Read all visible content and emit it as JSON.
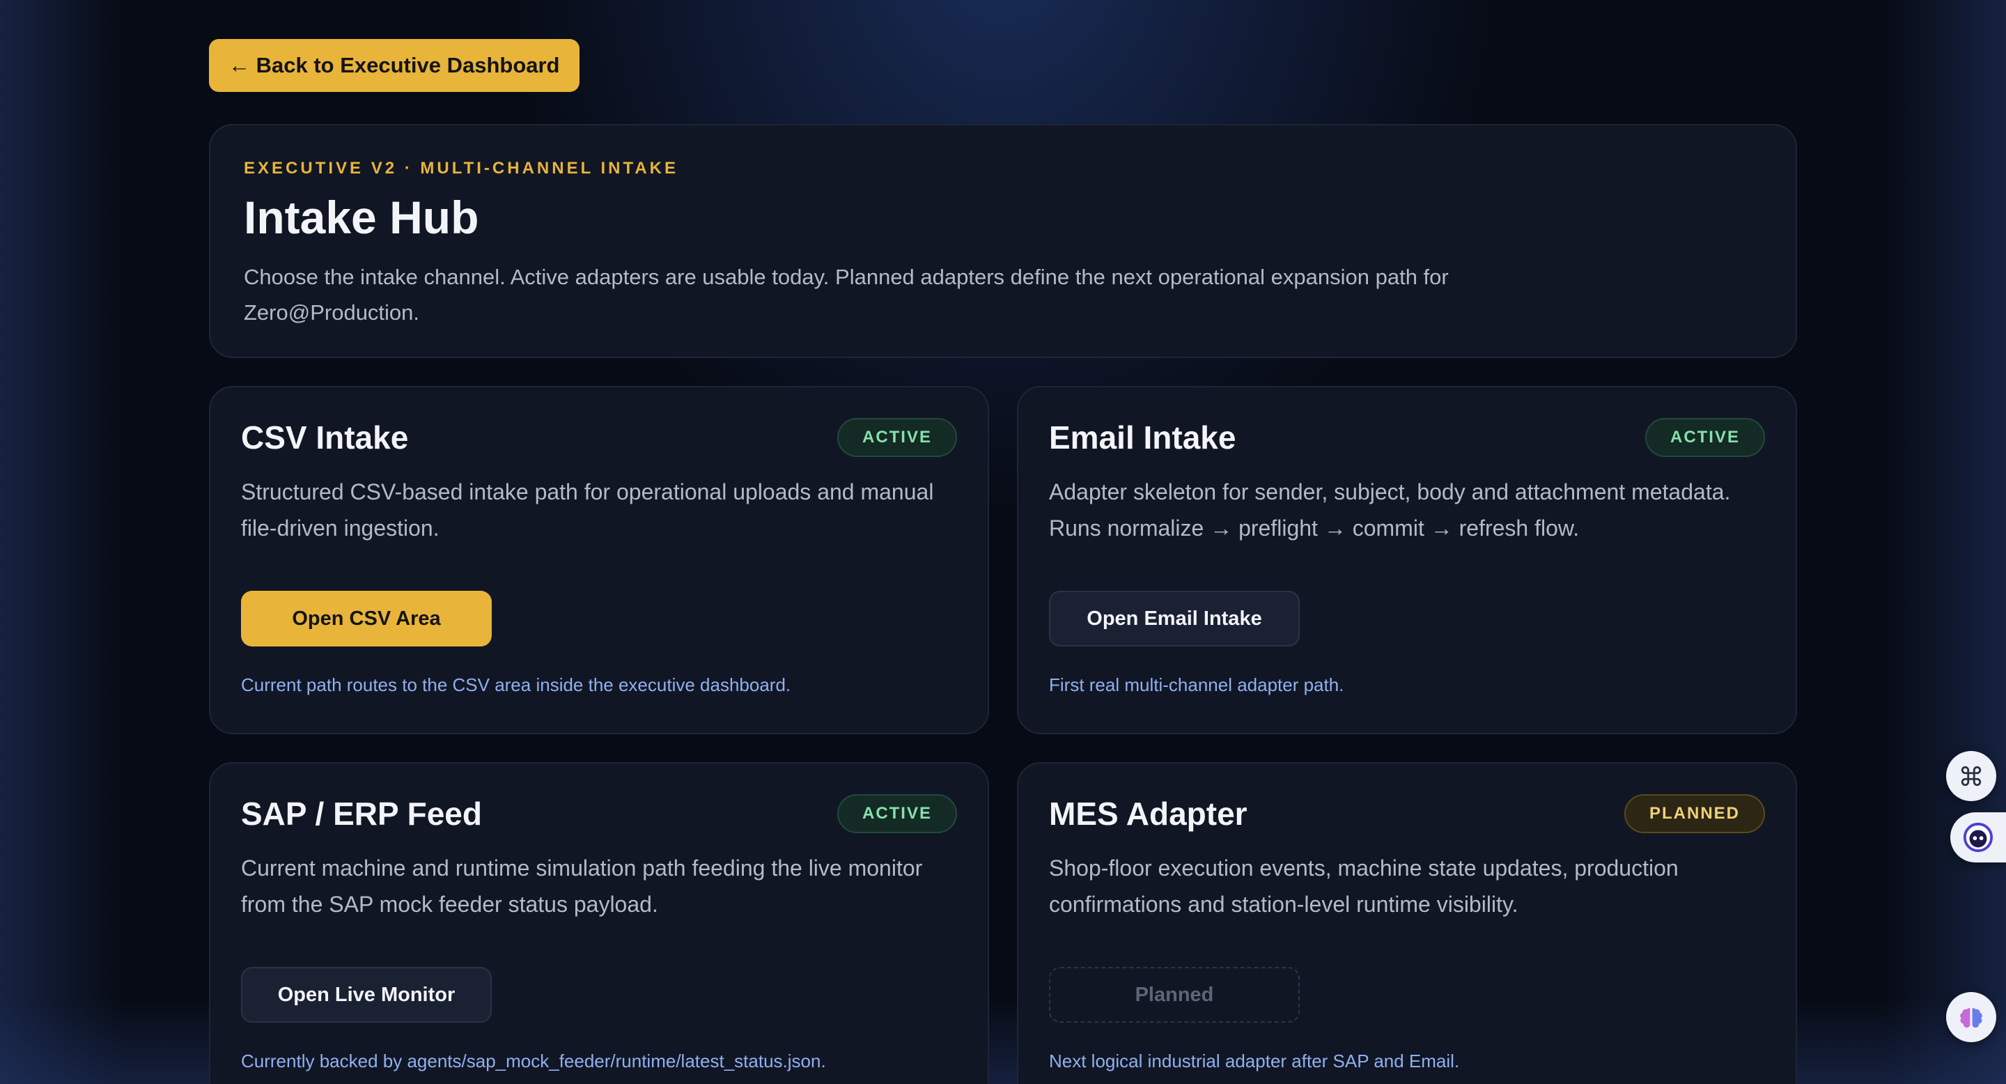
{
  "back_button": {
    "label": "← Back to Executive Dashboard"
  },
  "hero": {
    "eyebrow": "EXECUTIVE V2 · MULTI-CHANNEL INTAKE",
    "title": "Intake Hub",
    "description": "Choose the intake channel. Active adapters are usable today. Planned adapters define the next operational expansion path for Zero@Production."
  },
  "cards": [
    {
      "title": "CSV Intake",
      "status": "ACTIVE",
      "description": "Structured CSV-based intake path for operational uploads and manual file-driven ingestion.",
      "button": "Open CSV Area",
      "note": "Current path routes to the CSV area inside the executive dashboard."
    },
    {
      "title": "Email Intake",
      "status": "ACTIVE",
      "description": "Adapter skeleton for sender, subject, body and attachment metadata. Runs normalize → preflight → commit → refresh flow.",
      "button": "Open Email Intake",
      "note": "First real multi-channel adapter path."
    },
    {
      "title": "SAP / ERP Feed",
      "status": "ACTIVE",
      "description": "Current machine and runtime simulation path feeding the live monitor from the SAP mock feeder status payload.",
      "button": "Open Live Monitor",
      "note": "Currently backed by agents/sap_mock_feeder/runtime/latest_status.json."
    },
    {
      "title": "MES Adapter",
      "status": "PLANNED",
      "description": "Shop-floor execution events, machine state updates, production confirmations and station-level runtime visibility.",
      "button": "Planned",
      "note": "Next logical industrial adapter after SAP and Email."
    }
  ],
  "colors": {
    "accent": "#e8b43a",
    "background": "#070b15",
    "card": "#111624",
    "active": "#86e0aa",
    "planned": "#f0d27a",
    "note": "#8fb0f0"
  },
  "side_icons": [
    "command-icon",
    "assistant-face-icon",
    "brain-icon"
  ]
}
